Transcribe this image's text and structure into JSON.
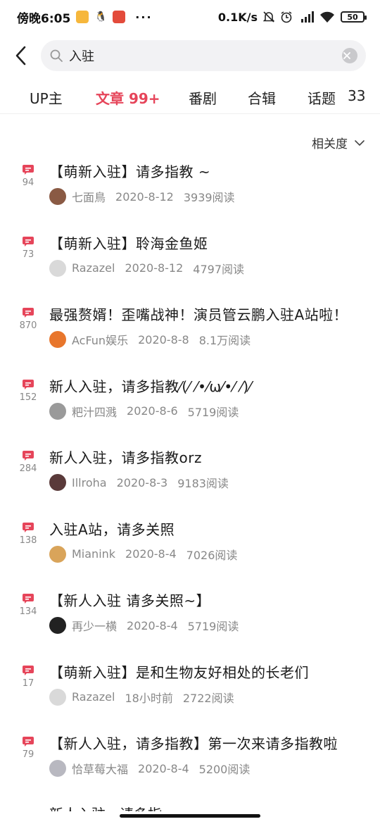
{
  "status_bar": {
    "time": "傍晚6:05",
    "dots": "···",
    "speed": "0.1K/s",
    "battery": "50"
  },
  "search": {
    "query": "入驻"
  },
  "tabs": [
    {
      "label": "UP主",
      "active": false
    },
    {
      "label": "文章 99+",
      "active": true
    },
    {
      "label": "番剧",
      "active": false
    },
    {
      "label": "合辑",
      "active": false
    },
    {
      "label": "话题",
      "active": false
    },
    {
      "label": "33",
      "active": false
    }
  ],
  "sort": {
    "label": "相关度"
  },
  "colors": {
    "accent": "#e6455a",
    "comment_icon": "#e6455a"
  },
  "articles": [
    {
      "comments": "94",
      "title": "【萌新入驻】请多指教 ~",
      "author": "七面鳥",
      "date": "2020-8-12",
      "reads": "3939阅读",
      "avatar_color": "#8a5a44"
    },
    {
      "comments": "73",
      "title": "【萌新入驻】聆海金鱼姬",
      "author": "Razazel",
      "date": "2020-8-12",
      "reads": "4797阅读",
      "avatar_color": "#d9d9d9"
    },
    {
      "comments": "870",
      "title": "最强赘婿！歪嘴战神！演员管云鹏入驻A站啦！",
      "author": "AcFun娱乐",
      "date": "2020-8-8",
      "reads": "8.1万阅读",
      "avatar_color": "#e8762c"
    },
    {
      "comments": "152",
      "title": "新人入驻，请多指教⁄(⁄ ⁄•⁄ω⁄•⁄ ⁄)⁄",
      "author": "粑汁四溅",
      "date": "2020-8-6",
      "reads": "5719阅读",
      "avatar_color": "#9a9a9a"
    },
    {
      "comments": "284",
      "title": "新人入驻，请多指教orz",
      "author": "Illroha",
      "date": "2020-8-3",
      "reads": "9183阅读",
      "avatar_color": "#5a3a3a"
    },
    {
      "comments": "138",
      "title": "入驻A站，请多关照",
      "author": "Mianink",
      "date": "2020-8-4",
      "reads": "7026阅读",
      "avatar_color": "#d9a45a"
    },
    {
      "comments": "134",
      "title": "【新人入驻 请多关照~】",
      "author": "再少一横",
      "date": "2020-8-4",
      "reads": "5719阅读",
      "avatar_color": "#222222"
    },
    {
      "comments": "17",
      "title": "【萌新入驻】是和生物友好相处的长老们",
      "author": "Razazel",
      "date": "18小时前",
      "reads": "2722阅读",
      "avatar_color": "#d9d9d9"
    },
    {
      "comments": "79",
      "title": "【新人入驻，请多指教】第一次来请多指教啦",
      "author": "恰草莓大福",
      "date": "2020-8-4",
      "reads": "5200阅读",
      "avatar_color": "#b8b8c0"
    }
  ]
}
